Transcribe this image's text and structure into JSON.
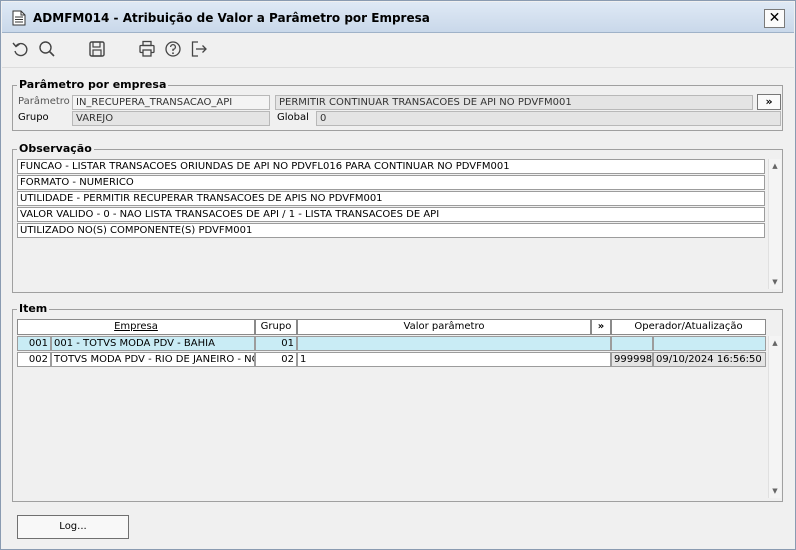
{
  "window": {
    "title": "ADMFM014 - Atribuição de Valor a Parâmetro por Empresa",
    "close_label": "✕"
  },
  "toolbar": {
    "icons": [
      "refresh-icon",
      "search-icon",
      "save-icon",
      "print-icon",
      "help-icon",
      "exit-icon"
    ]
  },
  "param_group": {
    "legend": "Parâmetro por empresa",
    "parametro_label": "Parâmetro",
    "parametro_value": "IN_RECUPERA_TRANSACAO_API",
    "descricao_value": "PERMITIR CONTINUAR TRANSACOES DE API NO PDVFM001",
    "expand_label": "»",
    "grupo_label": "Grupo",
    "grupo_value": "VAREJO",
    "global_label": "Global",
    "global_value": "0"
  },
  "observacao": {
    "legend": "Observação",
    "lines": [
      "FUNCAO - LISTAR TRANSACOES ORIUNDAS DE API NO PDVFL016 PARA CONTINUAR NO PDVFM001",
      "FORMATO - NUMERICO",
      "UTILIDADE - PERMITIR RECUPERAR TRANSACOES DE APIS NO PDVFM001",
      "VALOR VALIDO - 0 - NAO LISTA TRANSACOES DE API / 1 - LISTA TRANSACOES DE API",
      "UTILIZADO NO(S) COMPONENTE(S) PDVFM001"
    ]
  },
  "item": {
    "legend": "Item",
    "headers": {
      "empresa": "Empresa",
      "grupo": "Grupo",
      "valor": "Valor parâmetro",
      "expand": "»",
      "operador": "Operador/Atualização"
    },
    "rows": [
      {
        "num": "001",
        "empresa": "001 - TOTVS MODA PDV - BAHIA",
        "grupo": "01",
        "valor": "",
        "operador": "",
        "atualizacao": ""
      },
      {
        "num": "002",
        "empresa": "TOTVS MODA PDV - RIO DE JANEIRO - NO",
        "grupo": "02",
        "valor": "1",
        "operador": "999998",
        "atualizacao": "09/10/2024 16:56:50"
      }
    ]
  },
  "footer": {
    "log_label": "Log..."
  }
}
